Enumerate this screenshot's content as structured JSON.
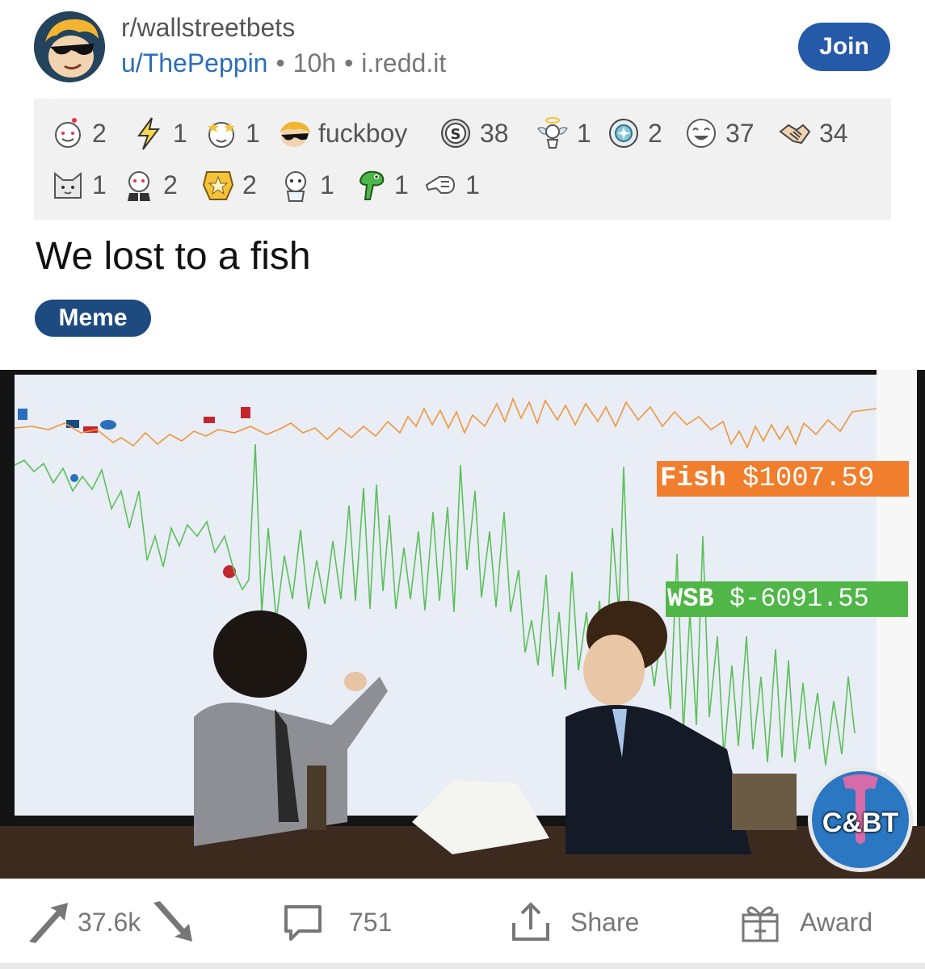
{
  "post": {
    "subreddit": "r/wallstreetbets",
    "author": "u/ThePeppin",
    "age": "10h",
    "domain": "i.redd.it",
    "separator": "•",
    "join_label": "Join",
    "title": "We lost to a fish",
    "flair": "Meme"
  },
  "awards": [
    {
      "icon": "wholesome-award-icon",
      "count": "2"
    },
    {
      "icon": "lightning-award-icon",
      "count": "1"
    },
    {
      "icon": "starstruck-award-icon",
      "count": "1"
    },
    {
      "icon": "fuckboy-award-icon",
      "count": "fuckboy"
    },
    {
      "icon": "silver-coin-award-icon",
      "count": "38"
    },
    {
      "icon": "angel-award-icon",
      "count": "1"
    },
    {
      "icon": "platinum-award-icon",
      "count": "2"
    },
    {
      "icon": "laughing-award-icon",
      "count": "37"
    },
    {
      "icon": "hand-shake-award-icon",
      "count": "34"
    },
    {
      "icon": "cat-award-icon",
      "count": "1"
    },
    {
      "icon": "snoo-suit-award-icon",
      "count": "2"
    },
    {
      "icon": "gold-award-icon",
      "count": "2"
    },
    {
      "icon": "helpful-award-icon",
      "count": "1"
    },
    {
      "icon": "gecko-award-icon",
      "count": "1"
    },
    {
      "icon": "pointing-hand-award-icon",
      "count": "1"
    }
  ],
  "media": {
    "fish_label": "Fish",
    "fish_value": "$1007.59",
    "wsb_label": "WSB",
    "wsb_value": "$-6091.55",
    "logo_text": "C&BT",
    "fish_color": "#f07e2c",
    "wsb_color": "#50b648"
  },
  "actions": {
    "score": "37.6k",
    "comments": "751",
    "share_label": "Share",
    "award_label": "Award"
  }
}
